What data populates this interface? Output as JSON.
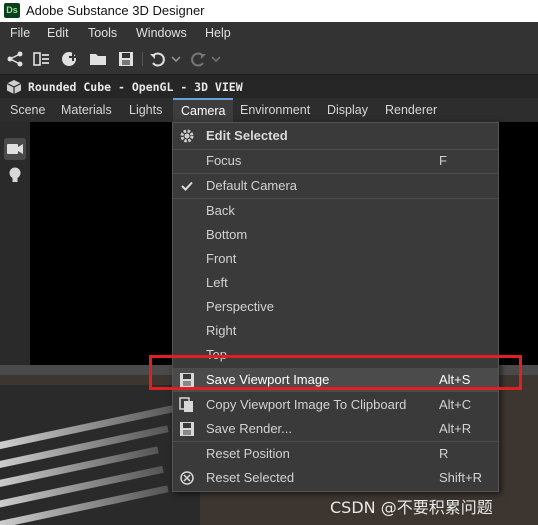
{
  "window": {
    "logo_text": "Ds",
    "title": "Adobe Substance 3D Designer"
  },
  "menubar": {
    "items": [
      "File",
      "Edit",
      "Tools",
      "Windows",
      "Help"
    ]
  },
  "toolbar": {
    "icons": [
      "new-graph-icon",
      "new-substance-icon",
      "new-resource-icon",
      "open-folder-icon",
      "save-icon",
      "undo-icon",
      "redo-icon"
    ]
  },
  "panel": {
    "title": "Rounded Cube - OpenGL - 3D VIEW"
  },
  "tabs": {
    "items": [
      "Scene",
      "Materials",
      "Lights",
      "Camera",
      "Environment",
      "Display",
      "Renderer"
    ],
    "active": "Camera"
  },
  "camera_menu": {
    "header": "Edit Selected",
    "items": [
      {
        "label": "Focus",
        "shortcut": "F"
      },
      {
        "label": "Default Camera",
        "shortcut": "",
        "checked": true
      },
      {
        "label": "Back",
        "shortcut": ""
      },
      {
        "label": "Bottom",
        "shortcut": ""
      },
      {
        "label": "Front",
        "shortcut": ""
      },
      {
        "label": "Left",
        "shortcut": ""
      },
      {
        "label": "Perspective",
        "shortcut": ""
      },
      {
        "label": "Right",
        "shortcut": ""
      },
      {
        "label": "Top",
        "shortcut": ""
      },
      {
        "label": "Save Viewport Image",
        "shortcut": "Alt+S"
      },
      {
        "label": "Copy Viewport Image To Clipboard",
        "shortcut": "Alt+C"
      },
      {
        "label": "Save Render...",
        "shortcut": "Alt+R"
      },
      {
        "label": "Reset Position",
        "shortcut": "R"
      },
      {
        "label": "Reset Selected",
        "shortcut": "Shift+R"
      }
    ]
  },
  "annotation": {
    "highlight_color": "#e02020"
  },
  "watermark": "CSDN @不要积累问题"
}
